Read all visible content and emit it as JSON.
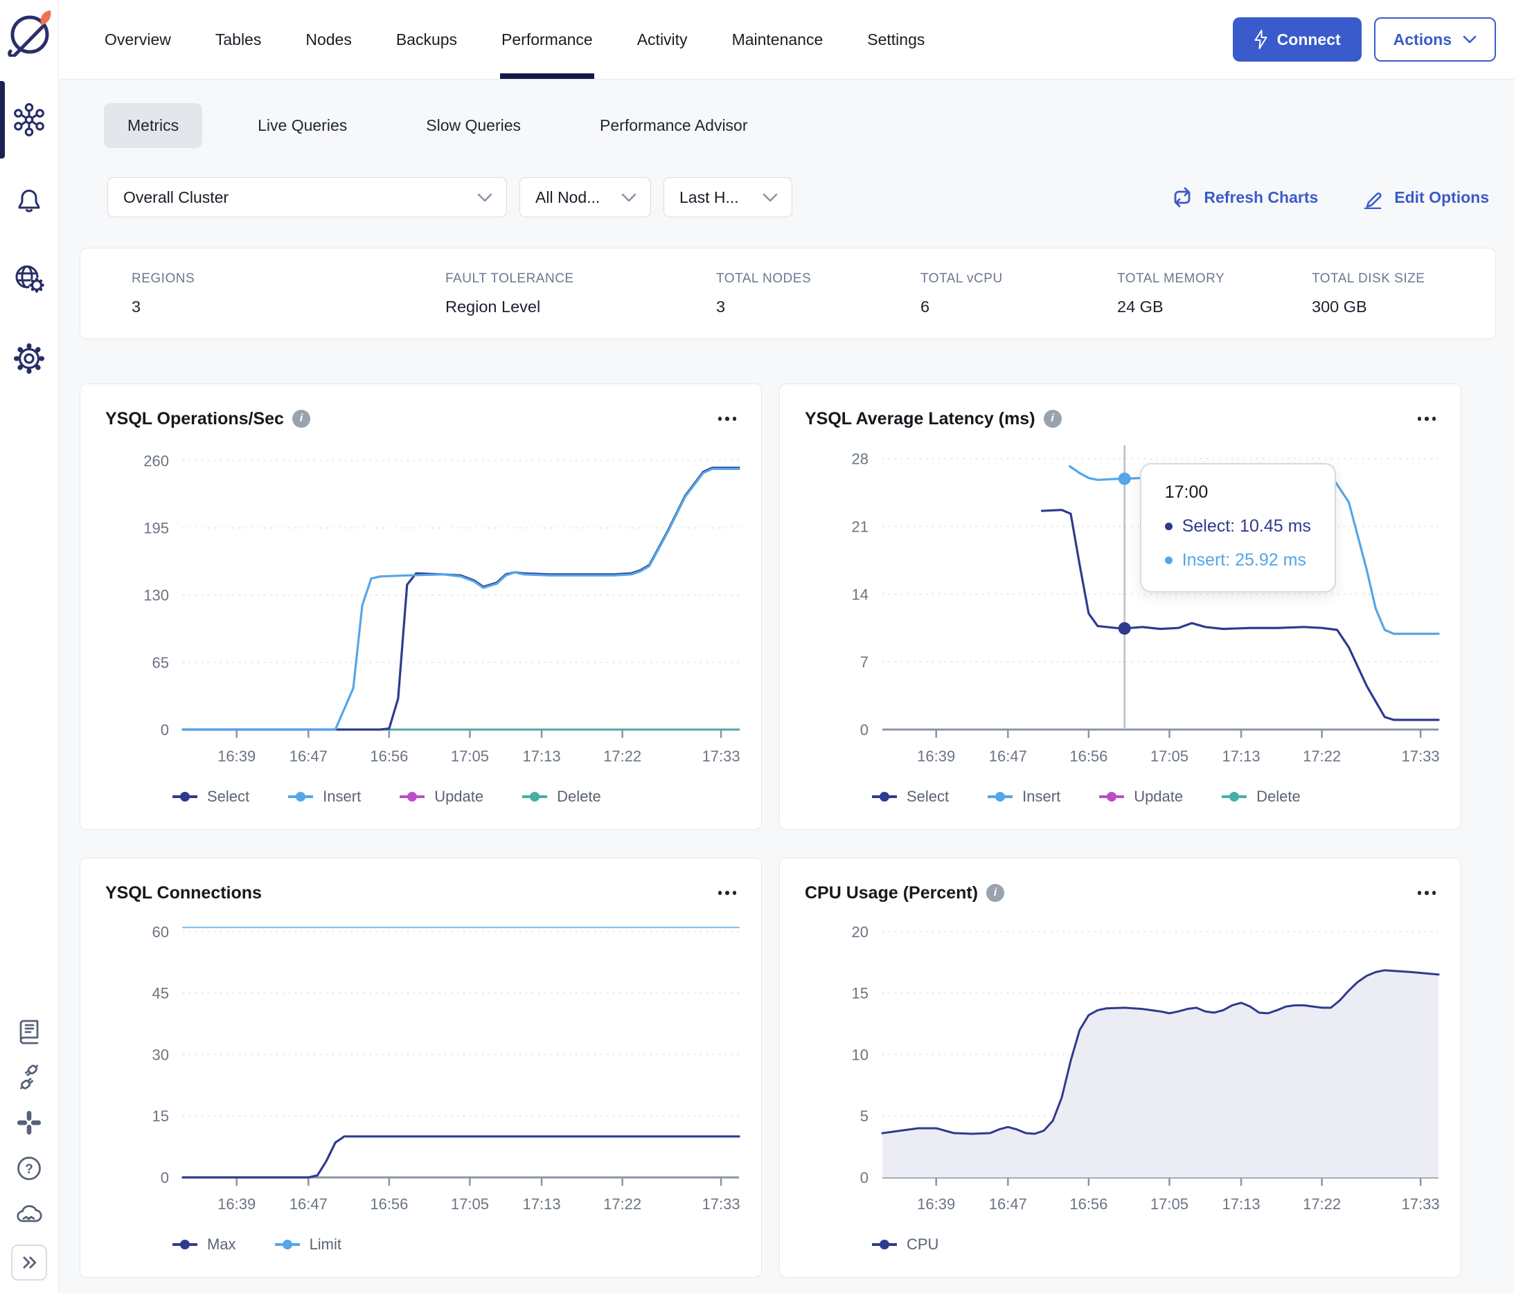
{
  "header": {
    "tabs": [
      "Overview",
      "Tables",
      "Nodes",
      "Backups",
      "Performance",
      "Activity",
      "Maintenance",
      "Settings"
    ],
    "active_tab": "Performance",
    "connect_label": "Connect",
    "actions_label": "Actions"
  },
  "subtabs": {
    "items": [
      "Metrics",
      "Live Queries",
      "Slow Queries",
      "Performance Advisor"
    ],
    "active": "Metrics"
  },
  "filters": {
    "cluster": "Overall Cluster",
    "nodes": "All Nod...",
    "time": "Last H...",
    "refresh": "Refresh Charts",
    "edit": "Edit Options"
  },
  "stats": {
    "items": [
      {
        "label": "REGIONS",
        "value": "3"
      },
      {
        "label": "FAULT TOLERANCE",
        "value": "Region Level"
      },
      {
        "label": "TOTAL NODES",
        "value": "3"
      },
      {
        "label": "TOTAL vCPU",
        "value": "6"
      },
      {
        "label": "TOTAL MEMORY",
        "value": "24 GB"
      },
      {
        "label": "TOTAL DISK SIZE",
        "value": "300 GB"
      }
    ]
  },
  "colors": {
    "accent": "#3A5BCB",
    "select_series": "#2F3A8D",
    "insert_series": "#54A6E8",
    "update_series": "#B94FC6",
    "delete_series": "#47AEA3",
    "cpu_fill": "#ECECF4"
  },
  "chart_data": [
    {
      "type": "line",
      "title": "YSQL Operations/Sec",
      "has_info_icon": true,
      "x_unit": "minutes-since-midnight",
      "x_domain": [
        993,
        1055
      ],
      "xticks": [
        {
          "label": "16:39",
          "t": 999
        },
        {
          "label": "16:47",
          "t": 1007
        },
        {
          "label": "16:56",
          "t": 1016
        },
        {
          "label": "17:05",
          "t": 1025
        },
        {
          "label": "17:13",
          "t": 1033
        },
        {
          "label": "17:22",
          "t": 1042
        },
        {
          "label": "17:33",
          "t": 1053
        }
      ],
      "yticks": [
        0,
        65,
        130,
        195,
        260
      ],
      "ylim": [
        0,
        275
      ],
      "series": [
        {
          "name": "Update",
          "color": "#B94FC6",
          "width": 2.5,
          "values": [
            [
              993,
              0
            ],
            [
              1055,
              0
            ]
          ]
        },
        {
          "name": "Delete",
          "color": "#47AEA3",
          "width": 2.5,
          "values": [
            [
              993,
              0
            ],
            [
              1055,
              0
            ]
          ]
        },
        {
          "name": "Select",
          "color": "#2F3A8D",
          "width": 3.2,
          "values": [
            [
              993,
              0
            ],
            [
              1015,
              0
            ],
            [
              1016,
              1
            ],
            [
              1017,
              30
            ],
            [
              1018,
              140
            ],
            [
              1019,
              151
            ],
            [
              1022,
              150
            ],
            [
              1024,
              149
            ],
            [
              1025.5,
              144
            ],
            [
              1026.5,
              138
            ],
            [
              1028,
              142
            ],
            [
              1029,
              150
            ],
            [
              1030,
              152
            ],
            [
              1031,
              151
            ],
            [
              1034,
              150
            ],
            [
              1038,
              150
            ],
            [
              1041,
              150
            ],
            [
              1043,
              151
            ],
            [
              1044,
              154
            ],
            [
              1045,
              159
            ],
            [
              1047,
              191
            ],
            [
              1049,
              226
            ],
            [
              1051,
              249
            ],
            [
              1052,
              253
            ],
            [
              1055,
              253
            ]
          ]
        },
        {
          "name": "Insert",
          "color": "#54A6E8",
          "width": 3.2,
          "values": [
            [
              993,
              0
            ],
            [
              1010,
              0
            ],
            [
              1012,
              40
            ],
            [
              1013,
              120
            ],
            [
              1014,
              146
            ],
            [
              1015,
              148
            ],
            [
              1018,
              149
            ],
            [
              1022,
              150
            ],
            [
              1024,
              148
            ],
            [
              1025.5,
              143
            ],
            [
              1026.5,
              137
            ],
            [
              1028,
              141
            ],
            [
              1029,
              149
            ],
            [
              1030,
              152
            ],
            [
              1031,
              150
            ],
            [
              1034,
              149
            ],
            [
              1038,
              149
            ],
            [
              1041,
              149
            ],
            [
              1043,
              150
            ],
            [
              1044,
              153
            ],
            [
              1045,
              158
            ],
            [
              1047,
              190
            ],
            [
              1049,
              225
            ],
            [
              1051,
              248
            ],
            [
              1052,
              252
            ],
            [
              1055,
              252
            ]
          ]
        }
      ],
      "legend": [
        {
          "label": "Select",
          "color": "#2F3A8D"
        },
        {
          "label": "Insert",
          "color": "#54A6E8"
        },
        {
          "label": "Update",
          "color": "#B94FC6"
        },
        {
          "label": "Delete",
          "color": "#47AEA3"
        }
      ]
    },
    {
      "type": "line",
      "title": "YSQL Average Latency (ms)",
      "has_info_icon": true,
      "x_unit": "minutes-since-midnight",
      "x_domain": [
        993,
        1055
      ],
      "xticks": [
        {
          "label": "16:39",
          "t": 999
        },
        {
          "label": "16:47",
          "t": 1007
        },
        {
          "label": "16:56",
          "t": 1016
        },
        {
          "label": "17:05",
          "t": 1025
        },
        {
          "label": "17:13",
          "t": 1033
        },
        {
          "label": "17:22",
          "t": 1042
        },
        {
          "label": "17:33",
          "t": 1053
        }
      ],
      "yticks": [
        0,
        7,
        14,
        21,
        28
      ],
      "ylim": [
        0,
        29.4
      ],
      "series": [
        {
          "name": "Select",
          "color": "#2F3A8D",
          "width": 3.2,
          "values": [
            [
              1010.8,
              22.6
            ],
            [
              1013,
              22.7
            ],
            [
              1014,
              22.3
            ],
            [
              1015,
              17
            ],
            [
              1016,
              12
            ],
            [
              1017,
              10.7
            ],
            [
              1019,
              10.5
            ],
            [
              1020,
              10.45
            ],
            [
              1022,
              10.6
            ],
            [
              1024,
              10.4
            ],
            [
              1026,
              10.5
            ],
            [
              1027.5,
              11.0
            ],
            [
              1029,
              10.6
            ],
            [
              1031,
              10.4
            ],
            [
              1034,
              10.5
            ],
            [
              1037,
              10.5
            ],
            [
              1040,
              10.6
            ],
            [
              1042,
              10.5
            ],
            [
              1043.7,
              10.3
            ],
            [
              1045,
              8.5
            ],
            [
              1047,
              4.5
            ],
            [
              1049,
              1.3
            ],
            [
              1050,
              1.0
            ],
            [
              1055,
              1.0
            ]
          ]
        },
        {
          "name": "Insert",
          "color": "#54A6E8",
          "width": 3.2,
          "values": [
            [
              1013.9,
              27.2
            ],
            [
              1015,
              26.5
            ],
            [
              1016,
              26.0
            ],
            [
              1017,
              25.8
            ],
            [
              1019,
              25.9
            ],
            [
              1020,
              25.92
            ],
            [
              1022,
              26.0
            ],
            [
              1024,
              26.1
            ],
            [
              1026,
              26.3
            ],
            [
              1028,
              26.3
            ],
            [
              1030,
              26.2
            ],
            [
              1033,
              26.1
            ],
            [
              1036,
              26.0
            ],
            [
              1039,
              26.0
            ],
            [
              1041,
              26.0
            ],
            [
              1043,
              25.9
            ],
            [
              1043.5,
              25.6
            ],
            [
              1045,
              23.5
            ],
            [
              1046,
              20
            ],
            [
              1047,
              16.5
            ],
            [
              1048,
              12.5
            ],
            [
              1049,
              10.3
            ],
            [
              1050,
              9.9
            ],
            [
              1055,
              9.9
            ]
          ]
        }
      ],
      "tooltip": {
        "t": 1020,
        "time_label": "17:00",
        "entries": [
          {
            "label": "Select",
            "value_text": "10.45 ms",
            "y": 10.45,
            "color": "#2F3A8D"
          },
          {
            "label": "Insert",
            "value_text": "25.92 ms",
            "y": 25.92,
            "color": "#54A6E8"
          }
        ]
      },
      "legend": [
        {
          "label": "Select",
          "color": "#2F3A8D"
        },
        {
          "label": "Insert",
          "color": "#54A6E8"
        },
        {
          "label": "Update",
          "color": "#B94FC6"
        },
        {
          "label": "Delete",
          "color": "#47AEA3"
        }
      ]
    },
    {
      "type": "line",
      "title": "YSQL Connections",
      "has_info_icon": false,
      "x_unit": "minutes-since-midnight",
      "x_domain": [
        993,
        1055
      ],
      "xticks": [
        {
          "label": "16:39",
          "t": 999
        },
        {
          "label": "16:47",
          "t": 1007
        },
        {
          "label": "16:56",
          "t": 1016
        },
        {
          "label": "17:05",
          "t": 1025
        },
        {
          "label": "17:13",
          "t": 1033
        },
        {
          "label": "17:22",
          "t": 1042
        },
        {
          "label": "17:33",
          "t": 1053
        }
      ],
      "yticks": [
        0,
        15,
        30,
        45,
        60
      ],
      "ylim": [
        0,
        63
      ],
      "series": [
        {
          "name": "Limit",
          "color": "#79BFEF",
          "width": 2,
          "values": [
            [
              993,
              61
            ],
            [
              1055,
              61
            ]
          ]
        },
        {
          "name": "Max",
          "color": "#2F3A8D",
          "width": 3.2,
          "values": [
            [
              993,
              0
            ],
            [
              1007,
              0
            ],
            [
              1008,
              0.5
            ],
            [
              1009,
              4
            ],
            [
              1010,
              8.5
            ],
            [
              1011,
              10
            ],
            [
              1055,
              10
            ]
          ]
        }
      ],
      "legend": [
        {
          "label": "Max",
          "color": "#2F3A8D"
        },
        {
          "label": "Limit",
          "color": "#54A6E8"
        }
      ]
    },
    {
      "type": "area",
      "title": "CPU Usage (Percent)",
      "has_info_icon": true,
      "x_unit": "minutes-since-midnight",
      "x_domain": [
        993,
        1055
      ],
      "xticks": [
        {
          "label": "16:39",
          "t": 999
        },
        {
          "label": "16:47",
          "t": 1007
        },
        {
          "label": "16:56",
          "t": 1016
        },
        {
          "label": "17:05",
          "t": 1025
        },
        {
          "label": "17:13",
          "t": 1033
        },
        {
          "label": "17:22",
          "t": 1042
        },
        {
          "label": "17:33",
          "t": 1053
        }
      ],
      "yticks": [
        0,
        5,
        10,
        15,
        20
      ],
      "ylim": [
        0,
        21
      ],
      "series": [
        {
          "name": "CPU",
          "color": "#2F3A8D",
          "width": 3,
          "area": true,
          "fill": "#ECECF4",
          "values": [
            [
              993,
              3.6
            ],
            [
              995,
              3.8
            ],
            [
              997,
              4.0
            ],
            [
              999,
              4.0
            ],
            [
              1000,
              3.8
            ],
            [
              1001,
              3.6
            ],
            [
              1003,
              3.55
            ],
            [
              1005,
              3.6
            ],
            [
              1006,
              3.9
            ],
            [
              1007,
              4.1
            ],
            [
              1008,
              3.9
            ],
            [
              1009,
              3.6
            ],
            [
              1010,
              3.55
            ],
            [
              1011,
              3.8
            ],
            [
              1012,
              4.6
            ],
            [
              1013,
              6.5
            ],
            [
              1014,
              9.5
            ],
            [
              1015,
              12
            ],
            [
              1016,
              13.2
            ],
            [
              1017,
              13.6
            ],
            [
              1018,
              13.75
            ],
            [
              1020,
              13.8
            ],
            [
              1022,
              13.7
            ],
            [
              1024,
              13.5
            ],
            [
              1025,
              13.35
            ],
            [
              1026,
              13.5
            ],
            [
              1027,
              13.7
            ],
            [
              1028,
              13.8
            ],
            [
              1029,
              13.5
            ],
            [
              1030,
              13.4
            ],
            [
              1031,
              13.6
            ],
            [
              1032,
              14.0
            ],
            [
              1033,
              14.2
            ],
            [
              1034,
              13.9
            ],
            [
              1035,
              13.4
            ],
            [
              1036,
              13.35
            ],
            [
              1037,
              13.6
            ],
            [
              1038,
              13.9
            ],
            [
              1039,
              14.0
            ],
            [
              1040,
              14.0
            ],
            [
              1041,
              13.9
            ],
            [
              1042,
              13.8
            ],
            [
              1043,
              13.8
            ],
            [
              1044,
              14.4
            ],
            [
              1045,
              15.2
            ],
            [
              1046,
              15.9
            ],
            [
              1047,
              16.4
            ],
            [
              1048,
              16.7
            ],
            [
              1049,
              16.85
            ],
            [
              1050,
              16.8
            ],
            [
              1052,
              16.7
            ],
            [
              1055,
              16.5
            ]
          ]
        }
      ],
      "legend": [
        {
          "label": "CPU",
          "color": "#2F3A8D"
        }
      ]
    }
  ]
}
